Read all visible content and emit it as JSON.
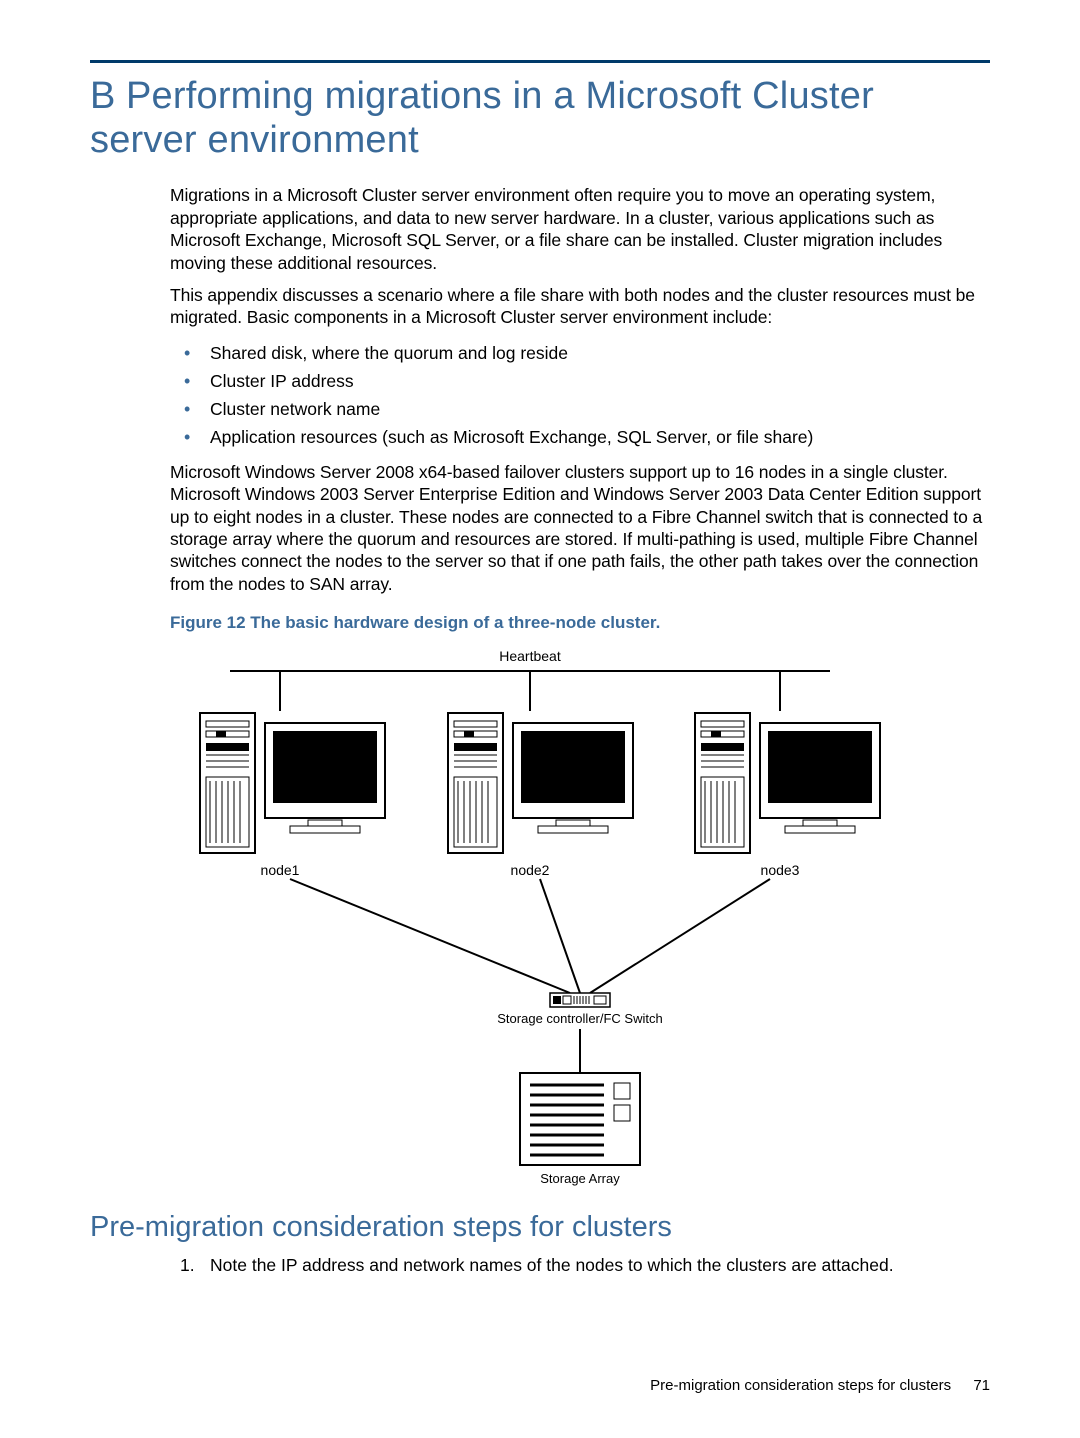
{
  "appendix": {
    "letter": "B",
    "title": "Performing migrations in a Microsoft Cluster server environment"
  },
  "paragraphs": {
    "p1": "Migrations in a Microsoft Cluster server environment often require you to move an operating system, appropriate applications, and data to new server hardware. In a cluster, various applications such as Microsoft Exchange, Microsoft SQL Server, or a file share can be installed. Cluster migration includes moving these additional resources.",
    "p2": "This appendix discusses a scenario where a file share with both nodes and the cluster resources must be migrated. Basic components in a Microsoft Cluster server environment include:",
    "p3": "Microsoft Windows Server 2008 x64-based failover clusters support up to 16 nodes in a single cluster. Microsoft Windows 2003 Server Enterprise Edition and Windows Server 2003 Data Center Edition support up to eight nodes in a cluster. These nodes are connected to a Fibre Channel switch that is connected to a storage array where the quorum and resources are stored. If multi-pathing is used, multiple Fibre Channel switches connect the nodes to the server so that if one path fails, the other path takes over the connection from the nodes to SAN array."
  },
  "bullets": [
    "Shared disk, where the quorum and log reside",
    "Cluster IP address",
    "Cluster network name",
    "Application resources (such as Microsoft Exchange, SQL Server, or file share)"
  ],
  "figure": {
    "caption": "Figure 12 The basic hardware design of a three-node cluster.",
    "labels": {
      "heartbeat": "Heartbeat",
      "node1": "node1",
      "node2": "node2",
      "node3": "node3",
      "switch": "Storage controller/FC Switch",
      "array": "Storage Array"
    }
  },
  "section2": {
    "title": "Pre-migration consideration steps for clusters",
    "steps": [
      "Note the IP address and network names of the nodes to which the clusters are attached."
    ]
  },
  "footer": {
    "text": "Pre-migration consideration steps for clusters",
    "page": "71"
  }
}
